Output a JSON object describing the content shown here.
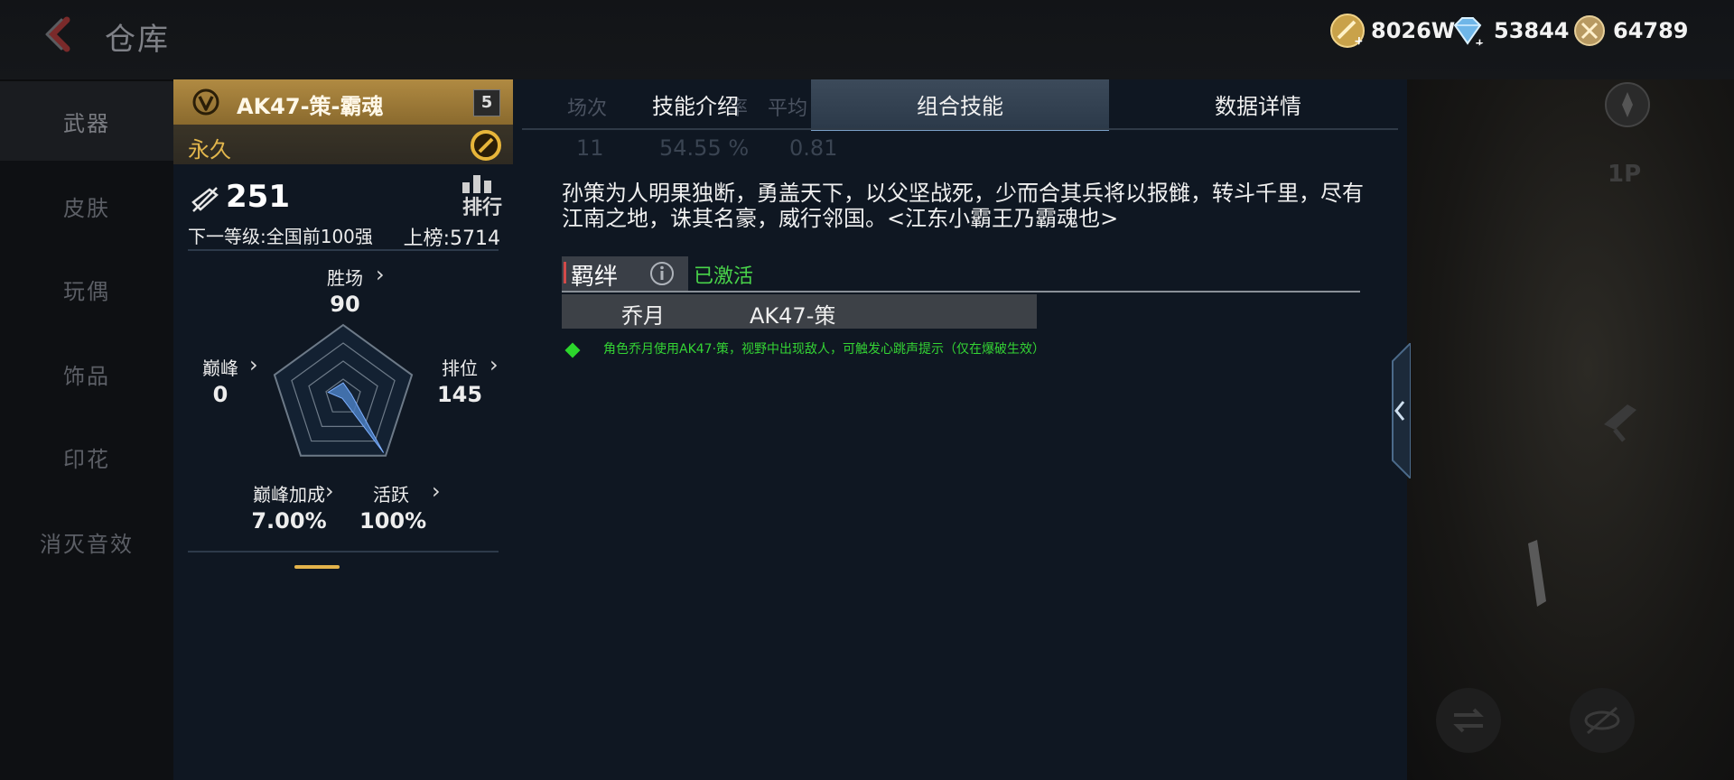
{
  "header": {
    "title": "仓库",
    "currencies": [
      {
        "icon": "gold-coin-icon",
        "value": "8026W"
      },
      {
        "icon": "diamond-icon",
        "value": "53844"
      },
      {
        "icon": "badge-coin-icon",
        "value": "64789"
      }
    ]
  },
  "sidebar": {
    "items": [
      {
        "label": "武器"
      },
      {
        "label": "皮肤"
      },
      {
        "label": "玩偶"
      },
      {
        "label": "饰品"
      },
      {
        "label": "印花"
      },
      {
        "label": "消灭音效"
      }
    ]
  },
  "weapon": {
    "name": "AK47-策-霸魂",
    "level": "5",
    "duration": "永久",
    "score": "251",
    "rank_label": "排行",
    "next_level": "下一等级:全国前100强",
    "on_list": "上榜:5714",
    "stats": {
      "wins": {
        "label": "胜场",
        "value": "90"
      },
      "peak": {
        "label": "巅峰",
        "value": "0"
      },
      "ranked": {
        "label": "排位",
        "value": "145"
      },
      "peak_bonus": {
        "label": "巅峰加成",
        "value": "7.00%"
      },
      "active": {
        "label": "活跃",
        "value": "100%"
      }
    }
  },
  "tabs": {
    "items": [
      {
        "label": "技能介绍"
      },
      {
        "label": "组合技能"
      },
      {
        "label": "数据详情"
      }
    ],
    "active_index": 1,
    "ghost": {
      "col1_label": "场次",
      "col1_value": "11",
      "col2_label": "率",
      "col2_value": "54.55 %",
      "col3_label": "平均",
      "col3_value": "0.81"
    }
  },
  "content": {
    "description": "孙策为人明果独断，勇盖天下，以父坚战死，少而合其兵将以报雠，转斗千里，尽有江南之地，诛其名豪，威行邻国。<江东小霸王乃霸魂也>",
    "bond": {
      "label": "羁绊",
      "status": "已激活",
      "character": "乔月",
      "weapon": "AK47-策",
      "effect": "角色乔月使用AK47·策，视野中出现敌人，可触发心跳声提示（仅在爆破生效）"
    }
  },
  "right_panel": {
    "mode_label": "1P"
  },
  "colors": {
    "accent_gold": "#e3b34b",
    "active_green": "#49d44a",
    "panel_bg": "#0f1722"
  }
}
